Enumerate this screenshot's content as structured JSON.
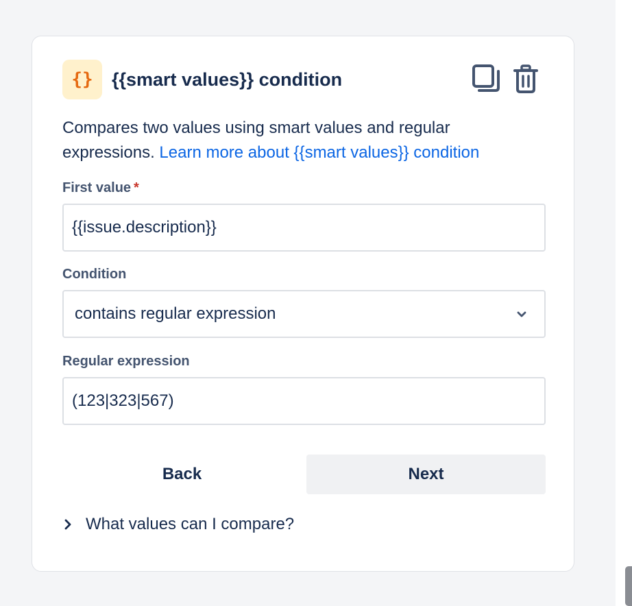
{
  "card": {
    "icon_glyph": "{}",
    "title": "{{smart values}} condition",
    "description": "Compares two values using smart values and regular expressions.",
    "learn_more_link": "Learn more about {{smart values}} condition",
    "colors": {
      "accent": "#e56910",
      "icon_bg": "#fff1cc",
      "link": "#0c66e4",
      "required": "#c9372c"
    }
  },
  "fields": {
    "first_value": {
      "label": "First value",
      "required_marker": "*",
      "value": "{{issue.description}}"
    },
    "condition": {
      "label": "Condition",
      "value": "contains regular expression"
    },
    "regex": {
      "label": "Regular expression",
      "value": "(123|323|567)"
    }
  },
  "actions": {
    "back_label": "Back",
    "next_label": "Next"
  },
  "help": {
    "label": "What values can I compare?"
  },
  "icons": {
    "copy": "copy-icon",
    "delete": "trash-icon",
    "chevron_down": "chevron-down-icon",
    "chevron_right": "chevron-right-icon"
  }
}
